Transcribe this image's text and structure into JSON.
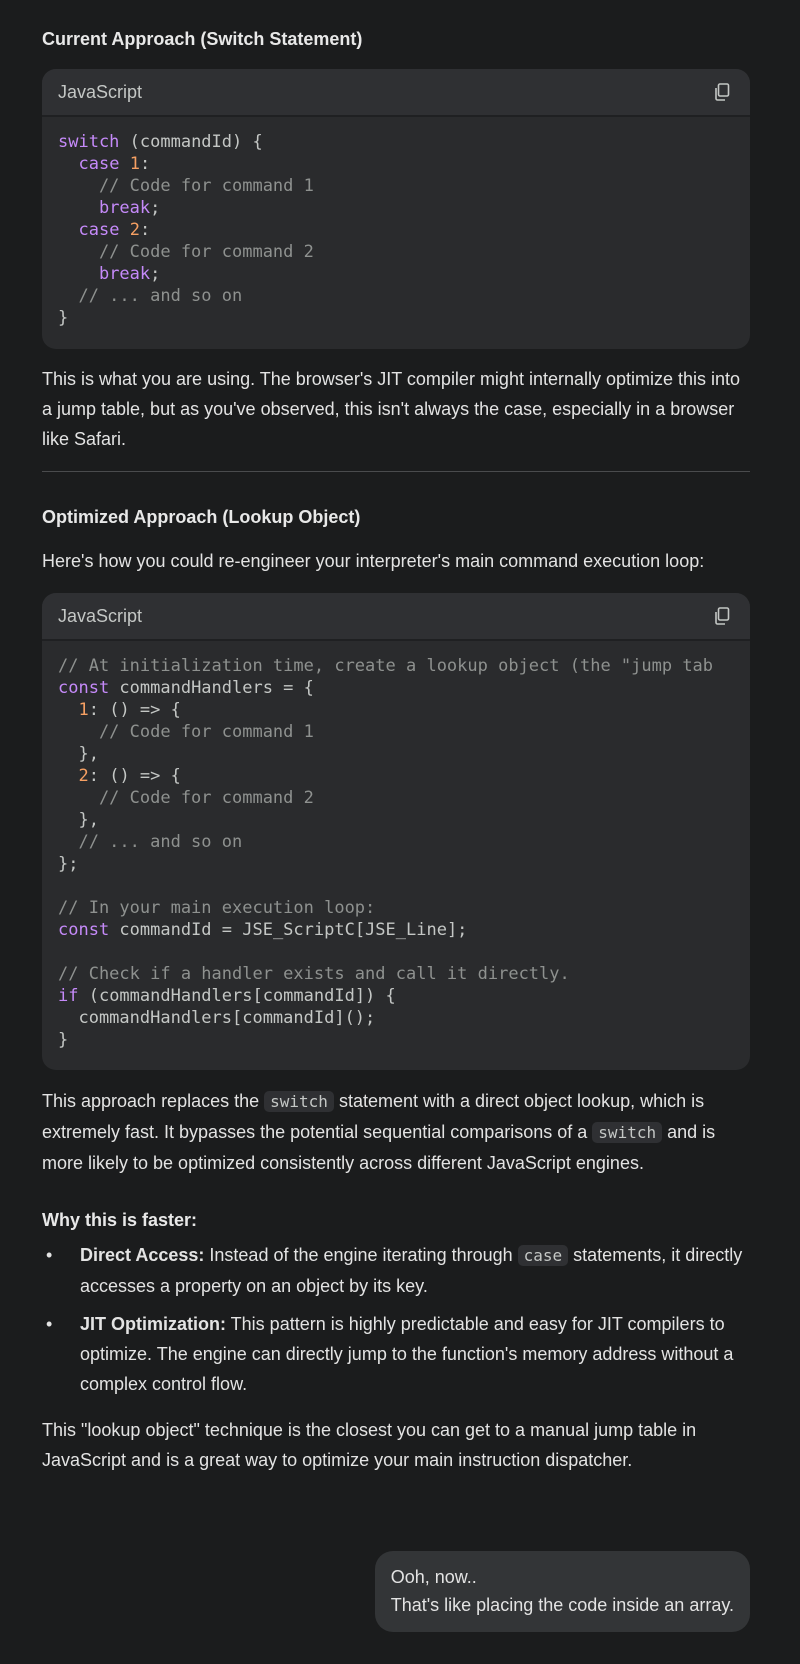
{
  "section1": {
    "heading": "Current Approach (Switch Statement)",
    "code_lang": "JavaScript",
    "copy_icon": "copy-icon",
    "code": [
      [
        {
          "t": "switch",
          "c": "kw"
        },
        {
          "t": " (commandId) {"
        }
      ],
      [
        {
          "t": "  "
        },
        {
          "t": "case",
          "c": "kw"
        },
        {
          "t": " "
        },
        {
          "t": "1",
          "c": "num"
        },
        {
          "t": ":"
        }
      ],
      [
        {
          "t": "    // Code for command 1",
          "c": "cm"
        }
      ],
      [
        {
          "t": "    "
        },
        {
          "t": "break",
          "c": "kw"
        },
        {
          "t": ";"
        }
      ],
      [
        {
          "t": "  "
        },
        {
          "t": "case",
          "c": "kw"
        },
        {
          "t": " "
        },
        {
          "t": "2",
          "c": "num"
        },
        {
          "t": ":"
        }
      ],
      [
        {
          "t": "    // Code for command 2",
          "c": "cm"
        }
      ],
      [
        {
          "t": "    "
        },
        {
          "t": "break",
          "c": "kw"
        },
        {
          "t": ";"
        }
      ],
      [
        {
          "t": "  // ... and so on",
          "c": "cm"
        }
      ],
      [
        {
          "t": "}"
        }
      ]
    ],
    "paragraph": "This is what you are using. The browser's JIT compiler might internally optimize this into a jump table, but as you've observed, this isn't always the case, especially in a browser like Safari."
  },
  "section2": {
    "heading": "Optimized Approach (Lookup Object)",
    "intro": "Here's how you could re-engineer your interpreter's main command execution loop:",
    "code_lang": "JavaScript",
    "copy_icon": "copy-icon",
    "code": [
      [
        {
          "t": "// At initialization time, create a lookup object (the \"jump tab",
          "c": "cm"
        }
      ],
      [
        {
          "t": "const",
          "c": "kw"
        },
        {
          "t": " commandHandlers = {"
        }
      ],
      [
        {
          "t": "  "
        },
        {
          "t": "1",
          "c": "num"
        },
        {
          "t": ": () => {"
        }
      ],
      [
        {
          "t": "    // Code for command 1",
          "c": "cm"
        }
      ],
      [
        {
          "t": "  },"
        }
      ],
      [
        {
          "t": "  "
        },
        {
          "t": "2",
          "c": "num"
        },
        {
          "t": ": () => {"
        }
      ],
      [
        {
          "t": "    // Code for command 2",
          "c": "cm"
        }
      ],
      [
        {
          "t": "  },"
        }
      ],
      [
        {
          "t": "  // ... and so on",
          "c": "cm"
        }
      ],
      [
        {
          "t": "};"
        }
      ],
      [
        {
          "t": ""
        }
      ],
      [
        {
          "t": "// In your main execution loop:",
          "c": "cm"
        }
      ],
      [
        {
          "t": "const",
          "c": "kw"
        },
        {
          "t": " commandId = JSE_ScriptC[JSE_Line];"
        }
      ],
      [
        {
          "t": ""
        }
      ],
      [
        {
          "t": "// Check if a handler exists and call it directly.",
          "c": "cm"
        }
      ],
      [
        {
          "t": "if",
          "c": "kw"
        },
        {
          "t": " (commandHandlers[commandId]) {"
        }
      ],
      [
        {
          "t": "  commandHandlers[commandId]();"
        }
      ],
      [
        {
          "t": "}"
        }
      ]
    ],
    "para1_a": "This approach replaces the ",
    "para1_code1": "switch",
    "para1_b": " statement with a direct object lookup, which is extremely fast. It bypasses the potential sequential comparisons of a ",
    "para1_code2": "switch",
    "para1_c": " and is more likely to be optimized consistently across different JavaScript engines."
  },
  "why": {
    "heading": "Why this is faster:",
    "bullet": "•",
    "item1_bold": "Direct Access:",
    "item1_a": " Instead of the engine iterating through ",
    "item1_code": "case",
    "item1_b": " statements, it directly accesses a property on an object by its key.",
    "item2_bold": "JIT Optimization:",
    "item2_text": " This pattern is highly predictable and easy for JIT compilers to optimize. The engine can directly jump to the function's memory address without a complex control flow."
  },
  "conclusion": "This \"lookup object\" technique is the closest you can get to a manual jump table in JavaScript and is a great way to optimize your main instruction dispatcher.",
  "user_message": {
    "line1": "Ooh, now..",
    "line2": "That's like placing the code inside an array."
  }
}
